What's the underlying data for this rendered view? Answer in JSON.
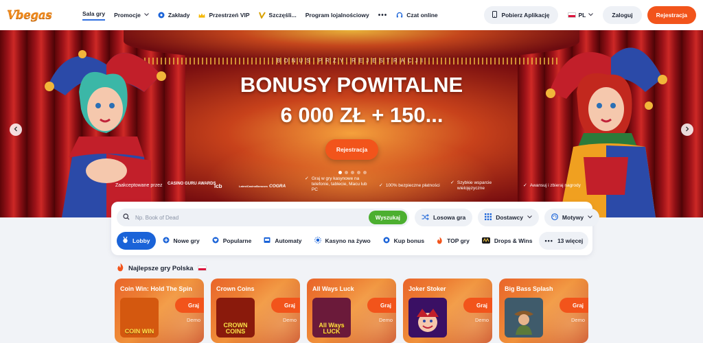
{
  "header": {
    "logo": "Vbegas",
    "nav": [
      {
        "label": "Sala gry",
        "icon": ""
      },
      {
        "label": "Promocje",
        "icon": "chevron-down-icon"
      },
      {
        "label": "Zakłady",
        "icon": "soccer-ball-icon"
      },
      {
        "label": "Przestrzeń VIP",
        "icon": "crown-icon"
      },
      {
        "label": "Szczęśli...",
        "icon": "horseshoe-icon"
      },
      {
        "label": "Program lojalnościowy",
        "icon": ""
      },
      {
        "label": "Czat online",
        "icon": "headset-icon"
      }
    ],
    "app_button": "Pobierz Aplikację",
    "language": "PL",
    "login": "Zaloguj",
    "register": "Rejestracja"
  },
  "hero": {
    "subtitle": "BONUS PRZY REJESTRACJI",
    "title": "BONUSY POWITALNE",
    "amount": "6 000 ZŁ + 150...",
    "cta": "Rejestracja",
    "slides": 5,
    "active_slide": 0,
    "accepted_label": "Zaakceptowane przez",
    "badges": [
      "CASINO GURU AWARDS",
      "lcb",
      "LatestCasinoBonuses",
      "COGRA"
    ],
    "features": [
      "Graj w gry kasynowe na telefonie, tablecie, Macu lub PC",
      "100% bezpieczne płatności",
      "Szybkie wsparcie wielojęzyczne",
      "Awansuj i zbieraj nagrody"
    ]
  },
  "search": {
    "placeholder": "Np. Book of Dead",
    "button": "Wyszukaj",
    "random": "Losowa gra",
    "providers": "Dostawcy",
    "themes": "Motywy"
  },
  "categories": [
    {
      "label": "Lobby",
      "icon": "medal-icon"
    },
    {
      "label": "Nowe gry",
      "icon": "plus-circle-icon"
    },
    {
      "label": "Popularne",
      "icon": "heart-icon"
    },
    {
      "label": "Automaty",
      "icon": "slot-machine-icon"
    },
    {
      "label": "Kasyno na żywo",
      "icon": "live-icon"
    },
    {
      "label": "Kup bonus",
      "icon": "coin-icon"
    },
    {
      "label": "TOP gry",
      "icon": "fire-icon"
    },
    {
      "label": "Drops & Wins",
      "icon": "drops-wins-icon"
    },
    {
      "label": "13 więcej",
      "icon": "more-dots-icon"
    }
  ],
  "section": {
    "title": "Najlepsze gry Polska"
  },
  "games": [
    {
      "name": "Coin Win: Hold The Spin",
      "thumb": "COIN WIN",
      "play": "Graj",
      "demo": "Demo",
      "color": "#d4580f"
    },
    {
      "name": "Crown Coins",
      "thumb": "CROWN COINS",
      "play": "Graj",
      "demo": "Demo",
      "color": "#8a1a0c"
    },
    {
      "name": "All Ways Luck",
      "thumb": "All Ways LUCK",
      "play": "Graj",
      "demo": "Demo",
      "color": "#6b1a3a"
    },
    {
      "name": "Joker Stoker",
      "thumb": "",
      "play": "Graj",
      "demo": "Demo",
      "color": "#3a1064"
    },
    {
      "name": "Big Bass Splash",
      "thumb": "",
      "play": "Graj",
      "demo": "Demo",
      "color": "#3f5b6b"
    }
  ],
  "colors": {
    "accent": "#f2541b",
    "primary": "#1a63d8",
    "search_green": "#4caf30"
  }
}
